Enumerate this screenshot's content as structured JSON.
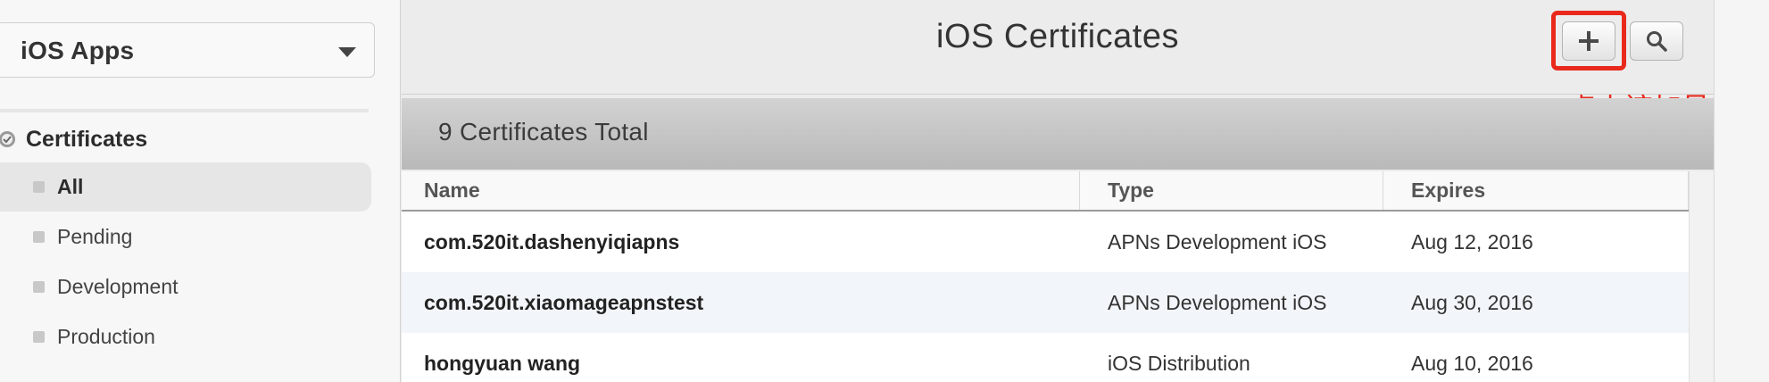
{
  "sidebar": {
    "platform_select": {
      "value": "iOS Apps"
    },
    "section": {
      "label": "Certificates",
      "icon": "certificate-gear-icon"
    },
    "items": [
      {
        "label": "All",
        "active": true
      },
      {
        "label": "Pending",
        "active": false
      },
      {
        "label": "Development",
        "active": false
      },
      {
        "label": "Production",
        "active": false
      }
    ]
  },
  "header": {
    "title": "iOS Certificates",
    "add_button": {
      "icon": "plus-icon"
    },
    "search_button": {
      "icon": "search-icon"
    },
    "annotation": "点击该加号",
    "highlight_color": "#e8291c"
  },
  "summary": {
    "text": "9 Certificates Total"
  },
  "table": {
    "columns": [
      "Name",
      "Type",
      "Expires"
    ],
    "rows": [
      {
        "name": "com.520it.dashenyiqiapns",
        "type": "APNs Development iOS",
        "expires": "Aug 12, 2016"
      },
      {
        "name": "com.520it.xiaomageapnstest",
        "type": "APNs Development iOS",
        "expires": "Aug 30, 2016"
      },
      {
        "name": "hongyuan wang",
        "type": "iOS Distribution",
        "expires": "Aug 10, 2016"
      }
    ]
  }
}
